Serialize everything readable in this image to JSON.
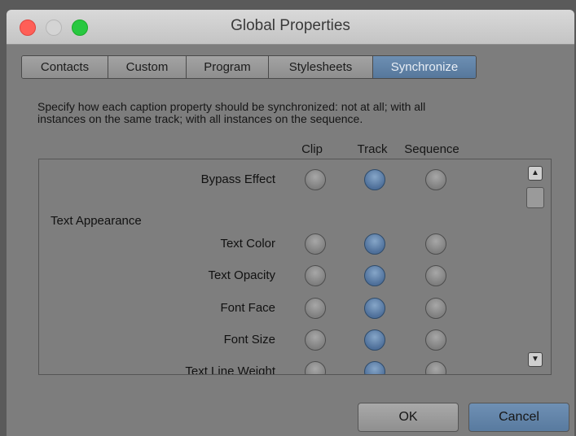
{
  "window": {
    "title": "Global Properties"
  },
  "tabs": [
    {
      "label": "Contacts",
      "active": false
    },
    {
      "label": "Custom",
      "active": false
    },
    {
      "label": "Program",
      "active": false
    },
    {
      "label": "Stylesheets",
      "active": false
    },
    {
      "label": "Synchronize",
      "active": true
    }
  ],
  "description": {
    "line1": "Specify how each caption property should be synchronized: not at all; with all",
    "line2": "instances on the same track; with all instances on the sequence."
  },
  "columns": [
    "Clip",
    "Track",
    "Sequence"
  ],
  "section_label": "Text Appearance",
  "rows": [
    {
      "label": "Bypass Effect",
      "selected": "Track"
    },
    {
      "label": "Text Color",
      "selected": "Track"
    },
    {
      "label": "Text Opacity",
      "selected": "Track"
    },
    {
      "label": "Font Face",
      "selected": "Track"
    },
    {
      "label": "Font Size",
      "selected": "Track"
    },
    {
      "label": "Text Line Weight",
      "selected": "Track"
    }
  ],
  "buttons": {
    "ok": "OK",
    "cancel": "Cancel"
  },
  "colors": {
    "accent": "#5f82a8",
    "background": "#7d7d7d"
  },
  "icons": {
    "scroll_up": "▲",
    "scroll_down": "▼"
  }
}
